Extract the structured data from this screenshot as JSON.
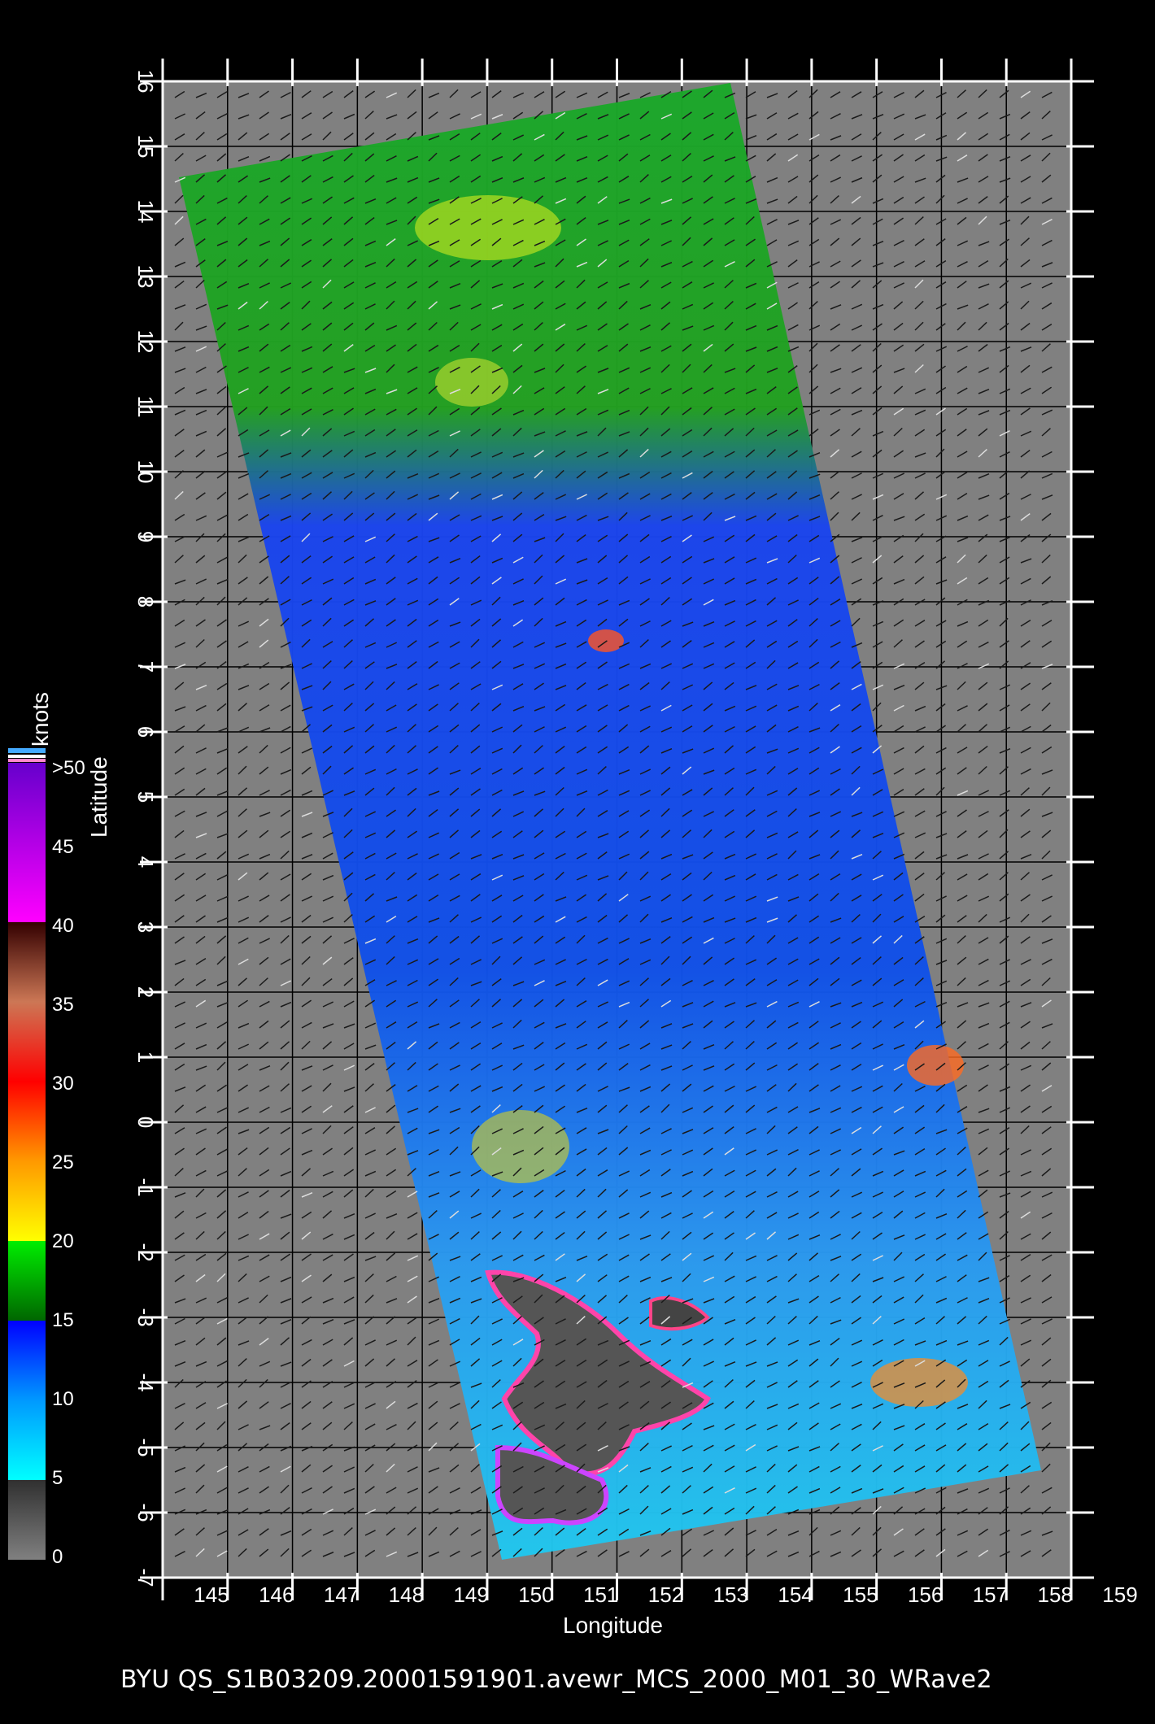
{
  "caption": "BYU  QS_S1B03209.20001591901.avewr_MCS_2000_M01_30_WRave2",
  "axes": {
    "xlabel": "Longitude",
    "ylabel": "Latitude",
    "x_ticks": [
      "145",
      "146",
      "147",
      "148",
      "149",
      "150",
      "151",
      "152",
      "153",
      "154",
      "155",
      "156",
      "157",
      "158",
      "159"
    ],
    "y_ticks": [
      "16",
      "15",
      "14",
      "13",
      "12",
      "11",
      "10",
      "9",
      "8",
      "7",
      "6",
      "5",
      "4",
      "3",
      "2",
      "1",
      "0",
      "-1",
      "-2",
      "-3",
      "-4",
      "-5",
      "-6",
      "-7"
    ],
    "lon_range": [
      145,
      159
    ],
    "lat_range": [
      -7,
      16
    ]
  },
  "colorbar": {
    "unit": "knots",
    "ticks": [
      ">50",
      "45",
      "40",
      "35",
      "30",
      "25",
      "20",
      "15",
      "10",
      "5",
      "0"
    ],
    "colors": {
      "c0": "#808080",
      "c5": "#00ffff",
      "c10": "#0066ff",
      "c15": "#008800",
      "c20": "#ffee00",
      "c25": "#ff8800",
      "c30": "#ff1100",
      "c35": "#cc6644",
      "c40": "#ff00ff",
      "c45": "#aa00cc",
      "c50": "#7700cc"
    }
  }
}
